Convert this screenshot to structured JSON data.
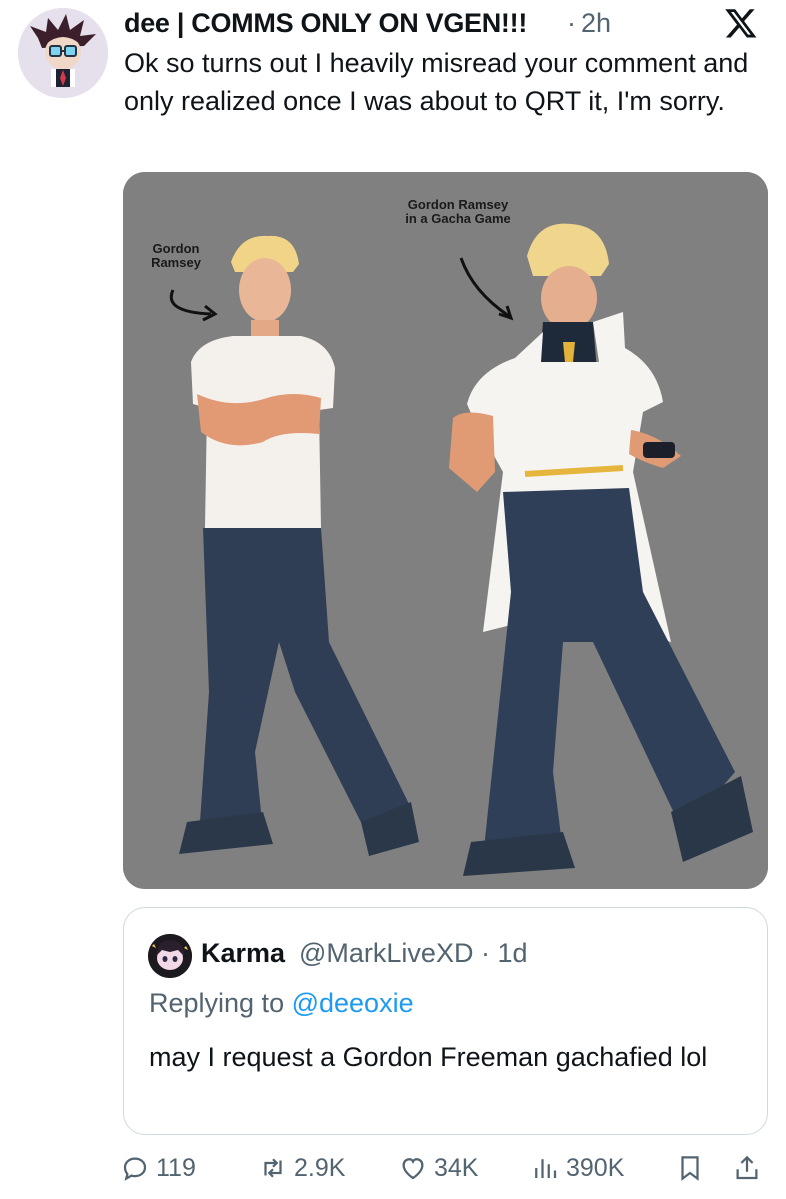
{
  "tweet": {
    "author_name": "dee | COMMS ONLY ON VGEN!!!",
    "separator": "·",
    "time": "2h",
    "text": "Ok so turns out I heavily misread your comment and only realized once I was about to QRT it, I'm sorry."
  },
  "media": {
    "label_left": "Gordon Ramsey",
    "label_right": "Gordon Ramsey in a Gacha Game"
  },
  "quote": {
    "name": "Karma",
    "handle_time": "@MarkLiveXD · 1d",
    "replying_prefix": "Replying to ",
    "replying_mention": "@deeoxie",
    "text": "may I request a Gordon Freeman gachafied lol"
  },
  "actions": {
    "replies": "119",
    "reposts": "2.9K",
    "likes": "34K",
    "views": "390K"
  },
  "icons": [
    "x-logo-icon",
    "reply-icon",
    "repost-icon",
    "like-icon",
    "views-icon",
    "bookmark-icon",
    "share-icon"
  ],
  "colors": {
    "text": "#0f1419",
    "secondary": "#536471",
    "link": "#1d9bf0",
    "border": "#cfd9de",
    "media_bg": "#808080"
  }
}
